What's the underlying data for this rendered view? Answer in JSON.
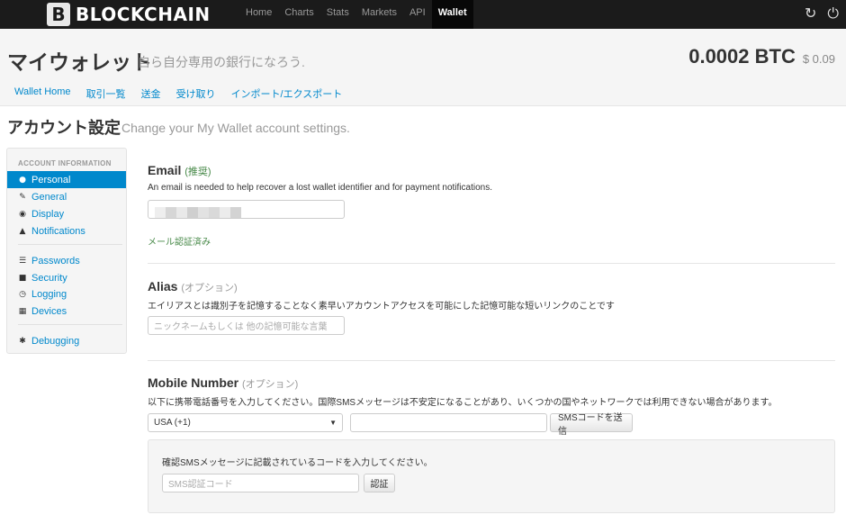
{
  "topbar": {
    "logo_mark": "B",
    "logo_text": "BLOCKCHAIN",
    "nav": [
      "Home",
      "Charts",
      "Stats",
      "Markets",
      "API",
      "Wallet"
    ],
    "active_nav": "Wallet",
    "icons": [
      "refresh-icon",
      "power-icon"
    ]
  },
  "header": {
    "title": "マイウォレット",
    "subtitle": "自ら自分専用の銀行になろう.",
    "balance_btc": "0.0002 BTC",
    "balance_usd": "$ 0.09",
    "subnav": [
      "Wallet Home",
      "取引一覧",
      "送金",
      "受け取り",
      "インポート/エクスポート"
    ]
  },
  "page": {
    "title": "アカウント設定",
    "subtitle": "Change your My Wallet account settings."
  },
  "sidebar": {
    "header": "ACCOUNT INFORMATION",
    "items": [
      {
        "label": "Personal",
        "icon": "user-icon",
        "active": true
      },
      {
        "label": "General",
        "icon": "wrench-icon"
      },
      {
        "label": "Display",
        "icon": "eye-icon"
      },
      {
        "label": "Notifications",
        "icon": "bell-icon"
      },
      {
        "label": "Passwords",
        "icon": "list-icon"
      },
      {
        "label": "Security",
        "icon": "lock-icon"
      },
      {
        "label": "Logging",
        "icon": "clock-icon"
      },
      {
        "label": "Devices",
        "icon": "qrcode-icon"
      },
      {
        "label": "Debugging",
        "icon": "bug-icon"
      }
    ]
  },
  "email": {
    "title": "Email",
    "tag": "(推奨)",
    "desc": "An email is needed to help recover a lost wallet identifier and for payment notifications.",
    "verified": "メール認証済み"
  },
  "alias": {
    "title": "Alias",
    "tag": "(オプション)",
    "desc": "エイリアスとは識別子を記憶することなく素早いアカウントアクセスを可能にした記憶可能な短いリンクのことです",
    "placeholder": "ニックネームもしくは 他の記憶可能な言葉"
  },
  "mobile": {
    "title": "Mobile Number",
    "tag": "(オプション)",
    "desc": "以下に携帯電話番号を入力してください。国際SMSメッセージは不安定になることがあり、いくつかの国やネットワークでは利用できない場合があります。",
    "country": "USA (+1)",
    "send_label": "SMSコードを送信",
    "verify_desc": "確認SMSメッセージに記載されているコードを入力してください。",
    "code_placeholder": "SMS認証コード",
    "verify_label": "認証"
  },
  "colors": {
    "accent": "#0088cc",
    "navbar": "#1b1b1b",
    "success": "#468847"
  }
}
